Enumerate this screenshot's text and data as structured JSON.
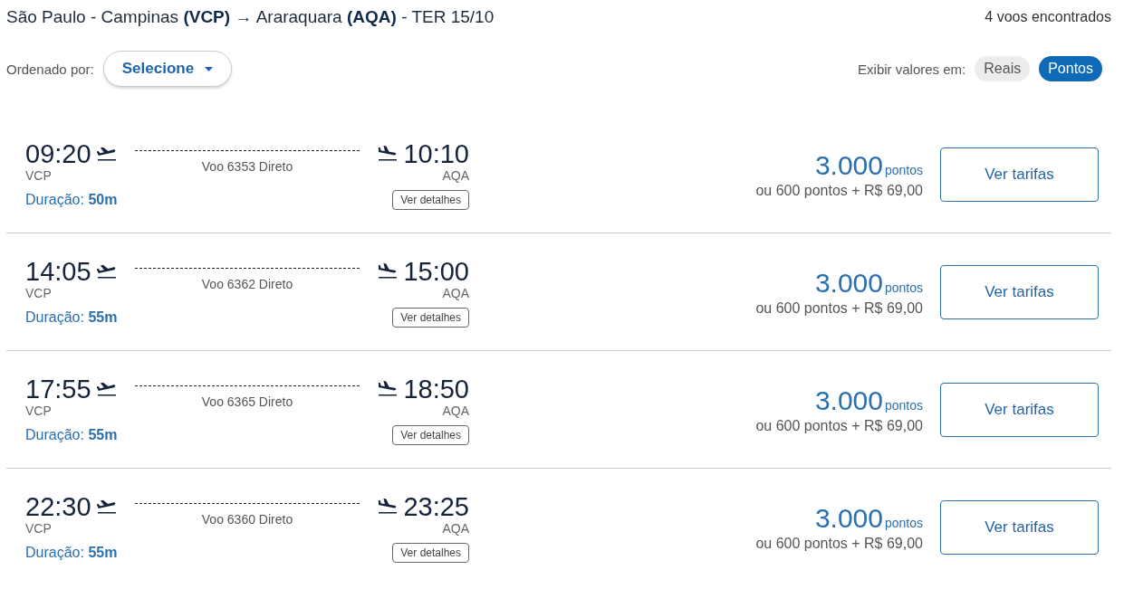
{
  "header": {
    "route": "São Paulo - Campinas **(VCP)** → Araraquara **(AQA)** - TER 15/10",
    "count": "4 voos encontrados"
  },
  "sort": {
    "label": "Ordenado por:",
    "value": "Selecione"
  },
  "display": {
    "label": "Exibir valores em:",
    "options": [
      {
        "label": "Reais",
        "selected": false
      },
      {
        "label": "Pontos",
        "selected": true
      }
    ]
  },
  "flights": [
    {
      "departure_time": "09:20",
      "departure_code": "VCP",
      "flight": "Voo 6353 Direto",
      "arrival_time": "10:10",
      "arrival_code": "AQA",
      "duration": "Duração: **50m**",
      "details": "Ver detalhes",
      "points": "3.000",
      "points_unit": "pontos",
      "alternative": "ou 600 pontos + R$ 69,00",
      "action": "Ver tarifas"
    },
    {
      "departure_time": "14:05",
      "departure_code": "VCP",
      "flight": "Voo 6362 Direto",
      "arrival_time": "15:00",
      "arrival_code": "AQA",
      "duration": "Duração: **55m**",
      "details": "Ver detalhes",
      "points": "3.000",
      "points_unit": "pontos",
      "alternative": "ou 600 pontos + R$ 69,00",
      "action": "Ver tarifas"
    },
    {
      "departure_time": "17:55",
      "departure_code": "VCP",
      "flight": "Voo 6365 Direto",
      "arrival_time": "18:50",
      "arrival_code": "AQA",
      "duration": "Duração: **55m**",
      "details": "Ver detalhes",
      "points": "3.000",
      "points_unit": "pontos",
      "alternative": "ou 600 pontos + R$ 69,00",
      "action": "Ver tarifas"
    },
    {
      "departure_time": "22:30",
      "departure_code": "VCP",
      "flight": "Voo 6360 Direto",
      "arrival_time": "23:25",
      "arrival_code": "AQA",
      "duration": "Duração: **55m**",
      "details": "Ver detalhes",
      "points": "3.000",
      "points_unit": "pontos",
      "alternative": "ou 600 pontos + R$ 69,00",
      "action": "Ver tarifas"
    }
  ]
}
